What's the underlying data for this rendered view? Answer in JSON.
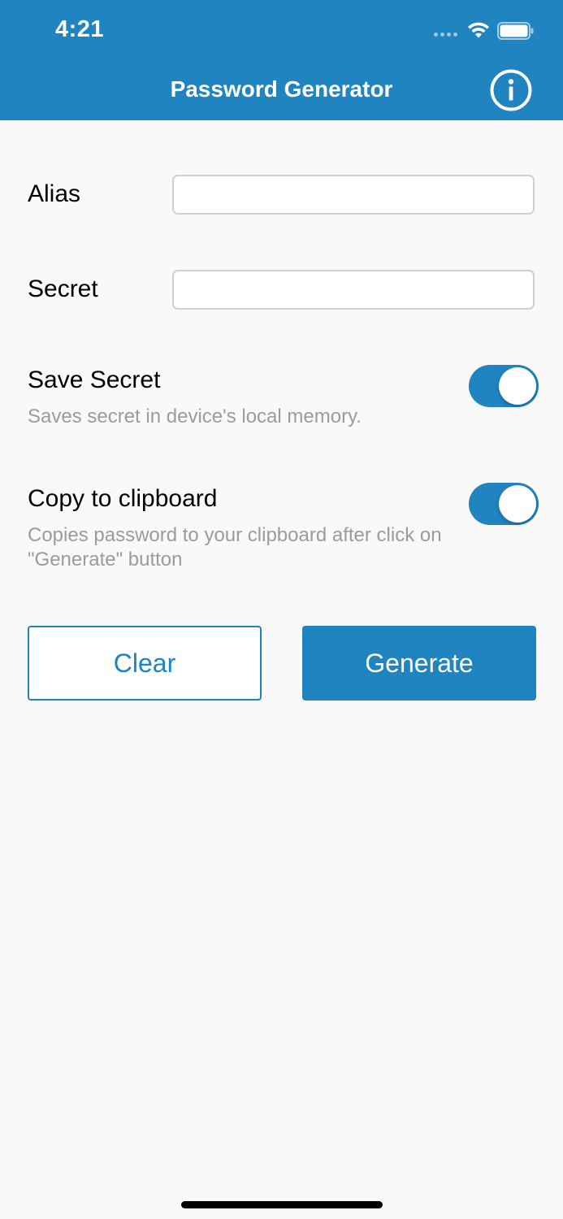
{
  "status_bar": {
    "time": "4:21"
  },
  "nav": {
    "title": "Password Generator",
    "info_icon": "info-circle-icon"
  },
  "form": {
    "alias_label": "Alias",
    "alias_value": "",
    "secret_label": "Secret",
    "secret_value": "",
    "save_secret": {
      "label": "Save Secret",
      "hint": "Saves secret in device's local memory.",
      "enabled": true
    },
    "copy_clipboard": {
      "label": "Copy to clipboard",
      "hint": "Copies password to your clipboard after click on \"Generate\" button",
      "enabled": true
    }
  },
  "buttons": {
    "clear_label": "Clear",
    "generate_label": "Generate"
  },
  "colors": {
    "accent": "#1f84bf",
    "background": "#f9f9f9",
    "hint_text": "#9b9b9b"
  }
}
